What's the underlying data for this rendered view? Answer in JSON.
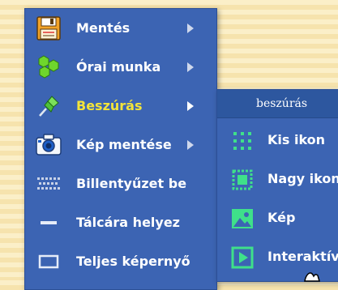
{
  "menu": {
    "items": [
      {
        "label": "Mentés",
        "icon": "floppy-disk-icon",
        "has_submenu": true
      },
      {
        "label": "Órai munka",
        "icon": "hexagons-icon",
        "has_submenu": true
      },
      {
        "label": "Beszúrás",
        "icon": "pushpin-icon",
        "has_submenu": true,
        "active": true
      },
      {
        "label": "Kép mentése",
        "icon": "camera-icon",
        "has_submenu": true
      },
      {
        "label": "Billentyűzet be",
        "icon": "keyboard-icon",
        "has_submenu": false
      },
      {
        "label": "Tálcára helyez",
        "icon": "minimize-icon",
        "has_submenu": false
      },
      {
        "label": "Teljes képernyő",
        "icon": "fullscreen-icon",
        "has_submenu": false
      }
    ]
  },
  "submenu": {
    "title": "beszúrás",
    "items": [
      {
        "label": "Kis ikon",
        "icon": "small-icon-grid-icon"
      },
      {
        "label": "Nagy ikon",
        "icon": "large-icon-icon"
      },
      {
        "label": "Kép",
        "icon": "image-icon"
      },
      {
        "label": "Interaktív",
        "icon": "play-box-icon"
      }
    ]
  },
  "colors": {
    "menu_bg": "#3c64b3",
    "submenu_header_bg": "#2d579f",
    "active_label": "#f3e43a",
    "icon_green": "#3fe08a",
    "background_stripe_light": "#fbefc8",
    "background_stripe_dark": "#f6e3ad"
  }
}
